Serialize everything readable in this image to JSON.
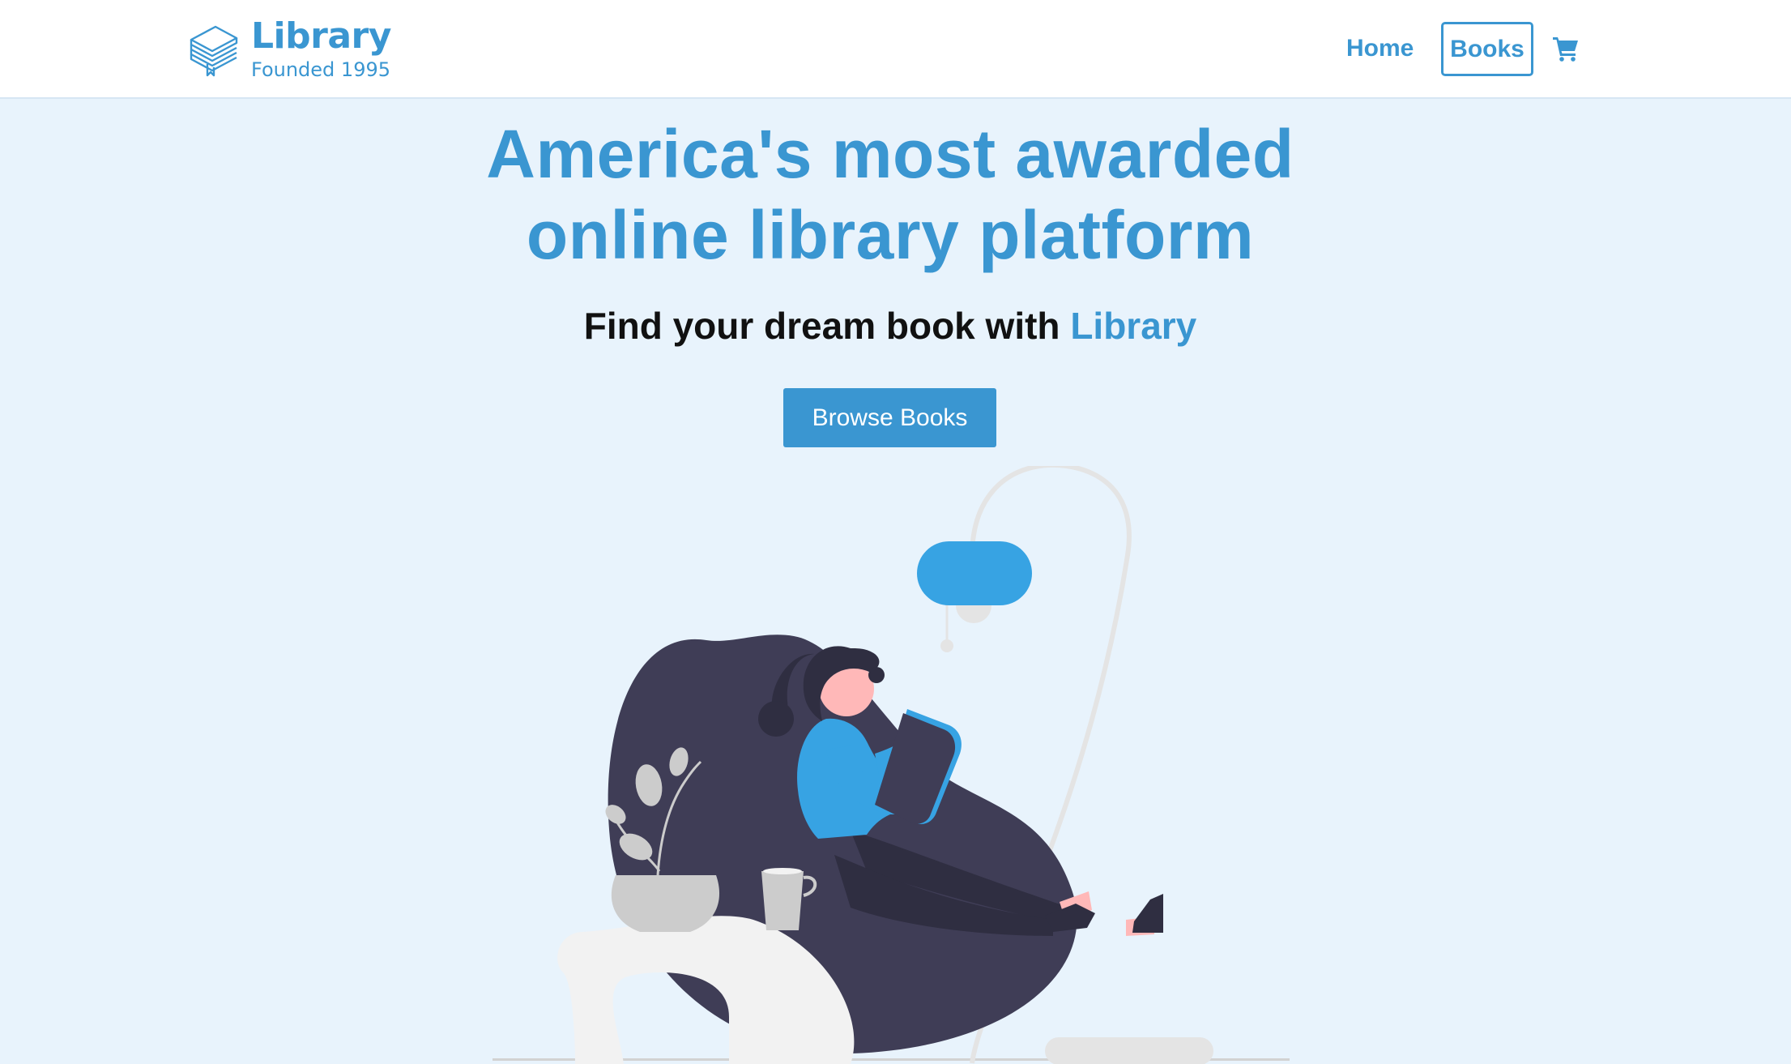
{
  "brand": {
    "name": "Library",
    "tagline": "Founded 1995",
    "logo_icon": "stacked-books-icon",
    "color": "#3a96d1"
  },
  "nav": {
    "items": [
      {
        "label": "Home"
      },
      {
        "label": "Books"
      }
    ],
    "cart_icon": "shopping-cart-icon"
  },
  "hero": {
    "title_line1": "America's most awarded",
    "title_line2": "online library platform",
    "subtitle_prefix": "Find your dream book with",
    "subtitle_accent": "Library",
    "cta_label": "Browse Books",
    "illustration": "woman-reading-book-in-beanbag-illustration"
  },
  "colors": {
    "accent": "#3a96d1",
    "background": "#e8f3fc",
    "dark": "#3f3d56",
    "lamp": "#37a3e3"
  }
}
